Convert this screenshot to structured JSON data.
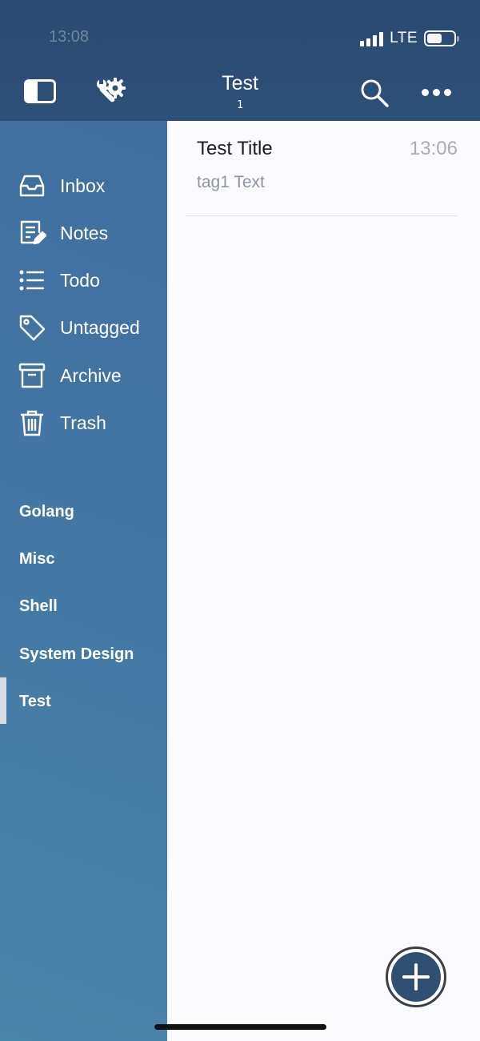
{
  "status_bar": {
    "time": "13:08",
    "network": "LTE"
  },
  "header": {
    "title": "Test",
    "count": "1"
  },
  "sidebar": {
    "items": [
      {
        "label": "Inbox",
        "icon": "inbox-icon"
      },
      {
        "label": "Notes",
        "icon": "notes-icon"
      },
      {
        "label": "Todo",
        "icon": "todo-list-icon"
      },
      {
        "label": "Untagged",
        "icon": "tag-icon"
      },
      {
        "label": "Archive",
        "icon": "archive-icon"
      },
      {
        "label": "Trash",
        "icon": "trash-icon"
      }
    ],
    "tags": [
      {
        "label": "Golang"
      },
      {
        "label": "Misc"
      },
      {
        "label": "Shell"
      },
      {
        "label": "System Design"
      },
      {
        "label": "Test"
      }
    ],
    "active_tag": "Test"
  },
  "notes": [
    {
      "title": "Test Title",
      "time": "13:06",
      "preview": "tag1 Text"
    }
  ],
  "colors": {
    "header_bg": "#2b4d75",
    "sidebar_bg": "#4478a5",
    "fab_bg": "#2f4f73"
  }
}
